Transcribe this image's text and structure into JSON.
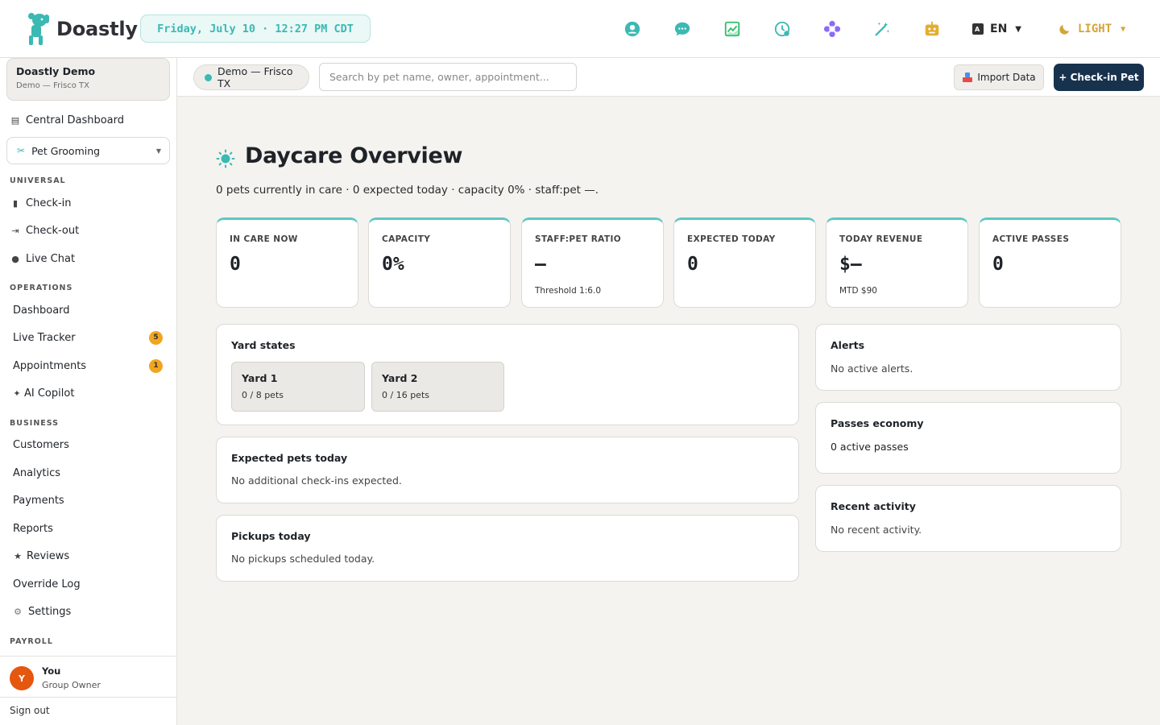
{
  "brand": {
    "name": "Doastly",
    "accent": "#3bb9b3"
  },
  "topbar": {
    "datetime": "Friday, July 10 · 12:27 PM CDT",
    "icons": [
      "support-icon",
      "chat-icon",
      "chart-icon",
      "clock-icon",
      "flower-icon",
      "magic-wand-icon",
      "robot-icon"
    ],
    "language": "EN",
    "theme": "LIGHT"
  },
  "sidebar": {
    "org": {
      "name": "Doastly Demo",
      "location": "Demo — Frisco TX"
    },
    "central_dashboard": "Central Dashboard",
    "module_select": "Pet Grooming",
    "sections": {
      "universal": "UNIVERSAL",
      "operations": "OPERATIONS",
      "business": "BUSINESS",
      "payroll": "PAYROLL"
    },
    "universal_items": [
      "Check-in",
      "Check-out",
      "Live Chat"
    ],
    "operations_items": [
      "Dashboard",
      "Live Tracker",
      "Appointments",
      "AI Copilot"
    ],
    "badges": {
      "live_tracker": "5",
      "appointments": "1"
    },
    "business_items": [
      "Customers",
      "Analytics",
      "Payments",
      "Reports",
      "Reviews",
      "Override Log",
      "Settings"
    ],
    "user": {
      "initial": "Y",
      "name": "You",
      "role": "Group Owner"
    },
    "sign_out": "Sign out"
  },
  "subheader": {
    "location": "Demo — Frisco TX",
    "search_placeholder": "Search by pet name, owner, appointment...",
    "import_label": "Import Data",
    "checkin_label": "+ Check-in Pet"
  },
  "main": {
    "title": "Daycare Overview",
    "subtitle": "0 pets currently in care · 0 expected today · capacity 0% · staff:pet —.",
    "stats": [
      {
        "label": "IN CARE NOW",
        "value": "0",
        "foot": ""
      },
      {
        "label": "CAPACITY",
        "value": "0%",
        "foot": ""
      },
      {
        "label": "STAFF:PET RATIO",
        "value": "—",
        "foot": "Threshold 1:6.0"
      },
      {
        "label": "EXPECTED TODAY",
        "value": "0",
        "foot": ""
      },
      {
        "label": "TODAY REVENUE",
        "value": "$—",
        "foot": "MTD $90"
      },
      {
        "label": "ACTIVE PASSES",
        "value": "0",
        "foot": ""
      }
    ],
    "yard_states": {
      "title": "Yard states",
      "yards": [
        {
          "name": "Yard 1",
          "count": "0 / 8 pets"
        },
        {
          "name": "Yard 2",
          "count": "0 / 16 pets"
        }
      ]
    },
    "expected": {
      "title": "Expected pets today",
      "body": "No additional check-ins expected."
    },
    "pickups": {
      "title": "Pickups today",
      "body": "No pickups scheduled today."
    },
    "alerts": {
      "title": "Alerts",
      "body": "No active alerts."
    },
    "passes": {
      "title": "Passes economy",
      "body": "0 active passes"
    },
    "activity": {
      "title": "Recent activity",
      "body": "No recent activity."
    }
  }
}
